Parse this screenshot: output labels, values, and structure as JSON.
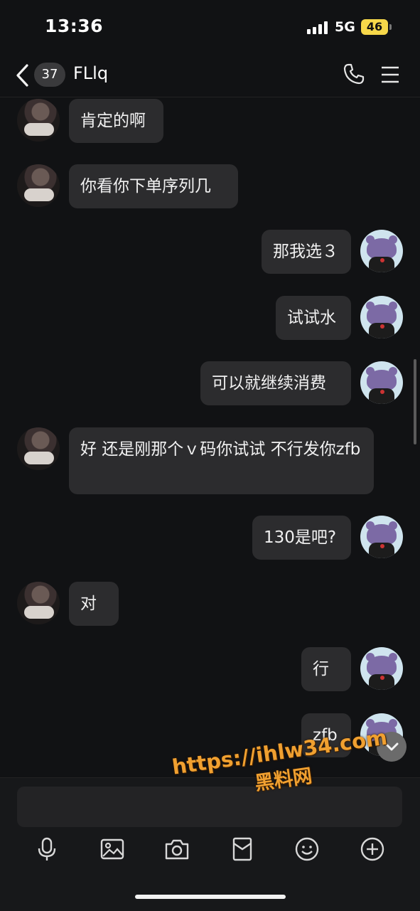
{
  "status_bar": {
    "time": "13:36",
    "network": "5G",
    "battery": "46"
  },
  "header": {
    "unread_count": "37",
    "contact_name": "FLlq"
  },
  "messages": [
    {
      "from": "other",
      "text": "肯定的啊"
    },
    {
      "from": "other",
      "text": "你看你下单序列几"
    },
    {
      "from": "self",
      "text": "那我选３"
    },
    {
      "from": "self",
      "text": "试试水"
    },
    {
      "from": "self",
      "text": "可以就继续消费"
    },
    {
      "from": "other",
      "text": "好 还是刚那个ｖ码你试试 不行发你zfb"
    },
    {
      "from": "self",
      "text": "130是吧?"
    },
    {
      "from": "other",
      "text": "对"
    },
    {
      "from": "self",
      "text": "行"
    },
    {
      "from": "self",
      "text": "zfb"
    }
  ],
  "input": {
    "placeholder": ""
  },
  "watermark": {
    "line1": "https://ihlw34.com",
    "line2": "黑料网"
  },
  "toolbar": [
    "microphone-icon",
    "image-icon",
    "camera-icon",
    "red-packet-icon",
    "emoji-icon",
    "plus-icon"
  ],
  "colors": {
    "background": "#111214",
    "bubble": "#2c2c2e",
    "battery": "#f7d84a",
    "watermark": "#f0a030"
  }
}
